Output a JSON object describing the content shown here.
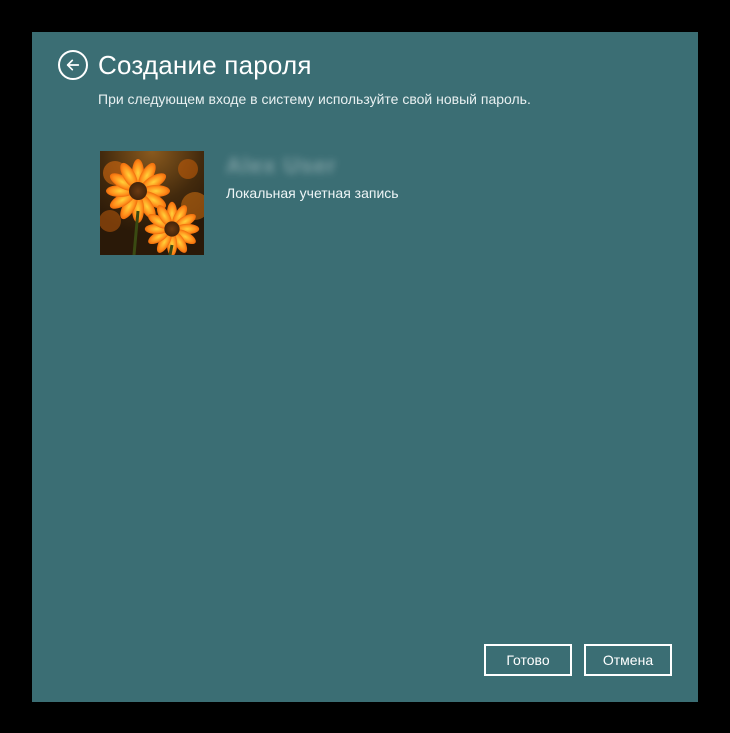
{
  "header": {
    "title": "Создание пароля",
    "subtitle": "При следующем входе в систему используйте свой новый пароль."
  },
  "account": {
    "username": "Alex User",
    "type": "Локальная учетная запись"
  },
  "footer": {
    "primary": "Готово",
    "secondary": "Отмена"
  }
}
